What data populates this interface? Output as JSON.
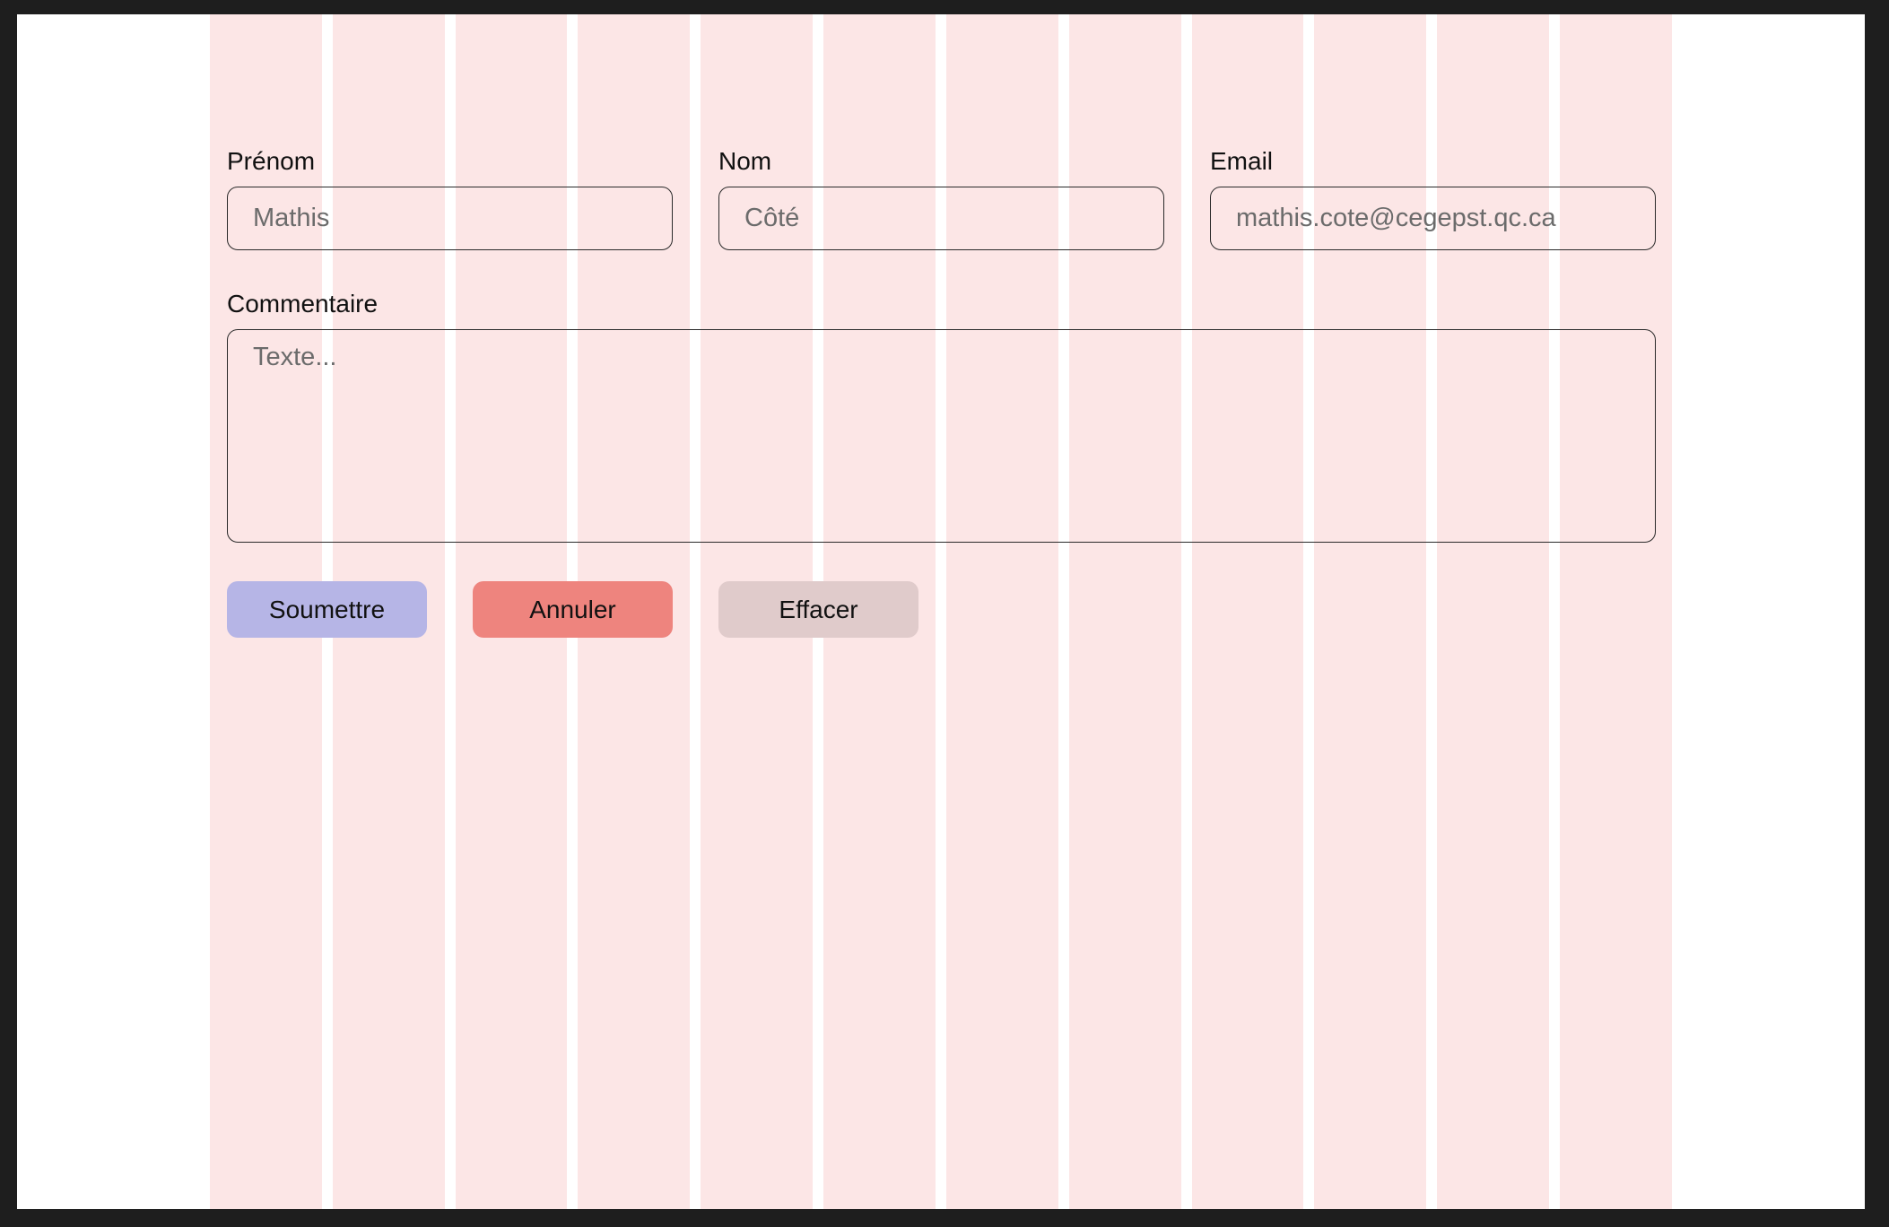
{
  "form": {
    "first_name": {
      "label": "Prénom",
      "placeholder": "Mathis"
    },
    "last_name": {
      "label": "Nom",
      "placeholder": "Côté"
    },
    "email": {
      "label": "Email",
      "placeholder": "mathis.cote@cegepst.qc.ca"
    },
    "comment": {
      "label": "Commentaire",
      "placeholder": "Texte..."
    }
  },
  "buttons": {
    "submit": "Soumettre",
    "cancel": "Annuler",
    "clear": "Effacer"
  },
  "colors": {
    "submit_bg": "#b6b5e6",
    "cancel_bg": "#ee847e",
    "clear_bg": "#e0cbcb",
    "grid_overlay": "#e94f4f"
  }
}
